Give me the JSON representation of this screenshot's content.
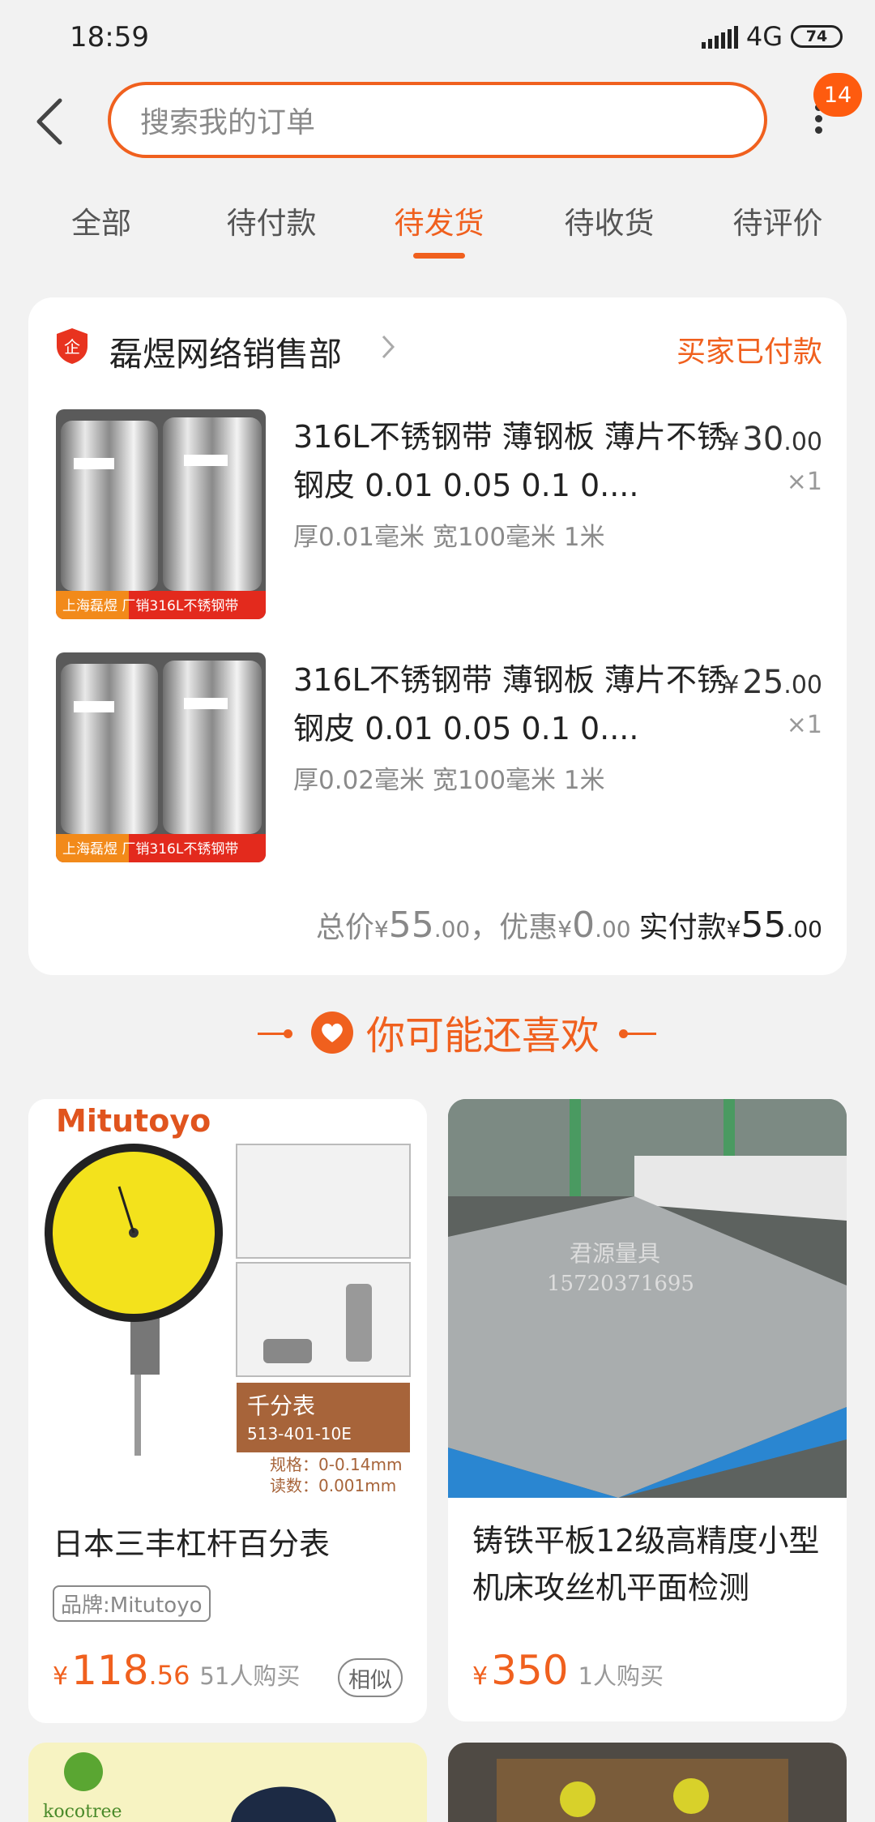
{
  "status_bar": {
    "time": "18:59",
    "network": "4G",
    "battery": "74"
  },
  "header": {
    "search_placeholder": "搜索我的订单",
    "notification_count": "14"
  },
  "tabs": [
    {
      "label": "全部"
    },
    {
      "label": "待付款"
    },
    {
      "label": "待发货"
    },
    {
      "label": "待收货"
    },
    {
      "label": "待评价"
    }
  ],
  "active_tab": "待发货",
  "order": {
    "shop_badge": "企",
    "shop_name": "磊煜网络销售部",
    "status": "买家已付款",
    "items": [
      {
        "thumb_text": "上海磊煜 厂销316L不锈钢带",
        "title": "316L不锈钢带 薄钢板 薄片不锈钢皮  0.01  0.05 0.1 0....",
        "sku": "厚0.01毫米 宽100毫米 1米",
        "price_currency": "¥",
        "price_int": "30",
        "price_dec": ".00",
        "qty": "×1"
      },
      {
        "thumb_text": "上海磊煜 厂销316L不锈钢带",
        "title": "316L不锈钢带 薄钢板 薄片不锈钢皮  0.01  0.05 0.1 0....",
        "sku": "厚0.02毫米 宽100毫米 1米",
        "price_currency": "¥",
        "price_int": "25",
        "price_dec": ".00",
        "qty": "×1"
      }
    ],
    "total": {
      "total_label": "总价",
      "total_int": "55",
      "total_dec": ".00",
      "discount_label": "，优惠",
      "discount_int": "0",
      "discount_dec": ".00",
      "pay_label": "实付款",
      "pay_int": "55",
      "pay_dec": ".00",
      "currency": "¥"
    }
  },
  "recommend": {
    "title": "你可能还喜欢",
    "cards": [
      {
        "image_brand": "Mitutoyo",
        "image_tag": "千分表",
        "image_model": "513-401-10E",
        "image_spec1": "规格：0-0.14mm",
        "image_spec2": "读数：0.001mm",
        "name": "日本三丰杠杆百分表",
        "brand": "品牌:Mitutoyo",
        "currency": "¥",
        "price_int": "118",
        "price_dec": ".56",
        "sold": "51人购买",
        "similar": "相似"
      },
      {
        "image_watermark1": "君源量具",
        "image_watermark2": "15720371695",
        "name": "铸铁平板12级高精度小型机床攻丝机平面检测",
        "currency": "¥",
        "price_int": "350",
        "price_dec": "",
        "sold": "1人购买"
      }
    ],
    "bottom_card_brand": "kocotree"
  }
}
